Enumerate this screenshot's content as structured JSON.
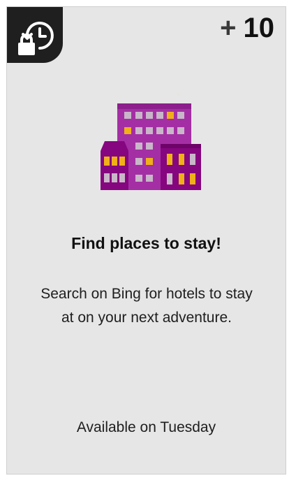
{
  "card": {
    "points_prefix": "+",
    "points_value": "10",
    "title": "Find places to stay!",
    "description": "Search on Bing for hotels to stay at on your next adventure.",
    "availability": "Available on Tuesday",
    "locked_icon": "lock-clock-icon",
    "illustration_icon": "hotel-buildings-moon-icon"
  },
  "colors": {
    "card_bg": "#e6e6e6",
    "corner_bg": "#1f1f1f",
    "building_main": "#a42fa4",
    "building_dark": "#86067f",
    "window_lit": "#f0b01a",
    "window_dim": "#c8b7c8",
    "moon": "#e8a622"
  }
}
